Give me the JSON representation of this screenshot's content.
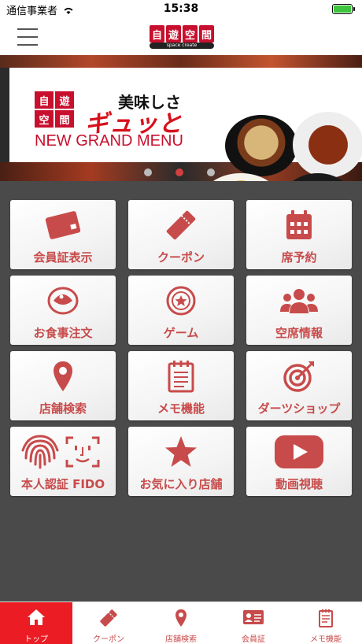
{
  "status_bar": {
    "carrier": "通信事業者",
    "time": "15:38"
  },
  "header": {
    "logo_chars": [
      "自",
      "遊",
      "空",
      "間"
    ],
    "logo_sub": "space create"
  },
  "banner": {
    "logo_chars": [
      "自",
      "遊",
      "空",
      "間"
    ],
    "line1": "美味しさ",
    "line2": "ギュッと",
    "line3": "NEW GRAND MENU"
  },
  "menu": [
    {
      "label": "会員証表示"
    },
    {
      "label": "クーポン"
    },
    {
      "label": "席予約"
    },
    {
      "label": "お食事注文"
    },
    {
      "label": "ゲーム"
    },
    {
      "label": "空席情報"
    },
    {
      "label": "店舗検索"
    },
    {
      "label": "メモ機能"
    },
    {
      "label": "ダーツショップ"
    },
    {
      "label": "本人認証 FIDO"
    },
    {
      "label": "お気に入り店舗"
    },
    {
      "label": "動画視聴"
    }
  ],
  "tabs": [
    {
      "label": "トップ"
    },
    {
      "label": "クーポン"
    },
    {
      "label": "店舗検索"
    },
    {
      "label": "会員証"
    },
    {
      "label": "メモ機能"
    }
  ],
  "colors": {
    "accent": "#c84b4b",
    "active_tab": "#ec1c24",
    "brand": "#c8102e"
  }
}
